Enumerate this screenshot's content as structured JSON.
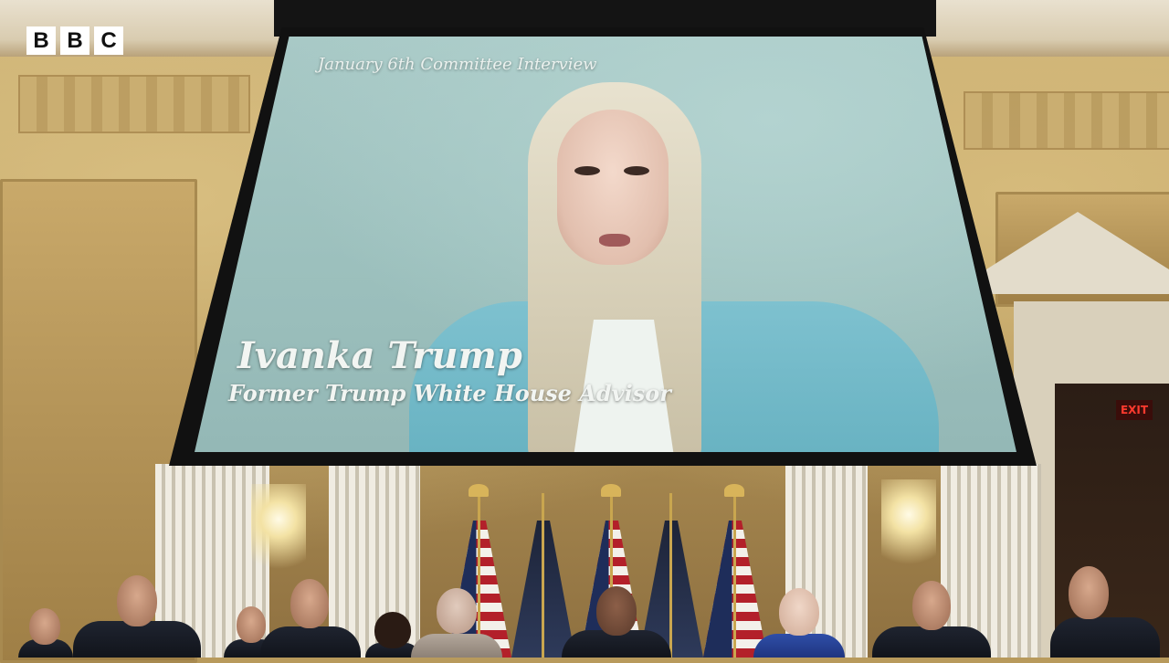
{
  "broadcaster": {
    "logo_letters": [
      "B",
      "B",
      "C"
    ]
  },
  "screen": {
    "label": "January 6th Committee Interview",
    "name": "Ivanka Trump",
    "title": "Former Trump White House Advisor"
  },
  "room": {
    "exit_sign": "EXIT"
  },
  "colors": {
    "screen_bg": "#a8c9c6",
    "wall": "#cfb57a",
    "jacket": "#7ec1cf"
  }
}
